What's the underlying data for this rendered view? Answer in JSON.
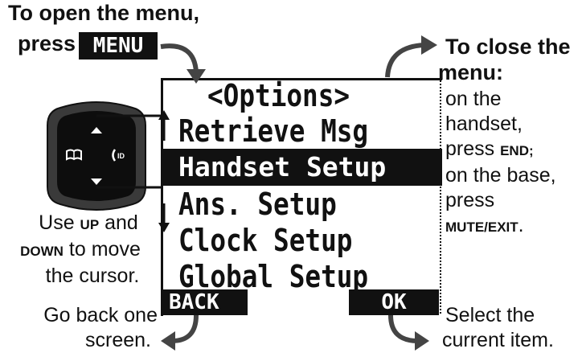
{
  "open_menu": {
    "line1": "To open the menu,",
    "line2": "press",
    "menu_key_label": "MENU"
  },
  "close_menu": {
    "heading1": "To close the",
    "heading2": "menu:",
    "lines": [
      "on the",
      "handset,",
      "press ",
      "on the base,",
      "press"
    ],
    "end_key": "END",
    "end_suffix": ";",
    "mute_exit_key": "MUTE/EXIT",
    "mute_suffix": "."
  },
  "screen": {
    "title": "<Options>",
    "options": [
      "Retrieve Msg",
      "Handset Setup",
      "Ans. Setup",
      "Clock Setup",
      "Global Setup"
    ],
    "selected_index": 1,
    "back_softkey": "BACK",
    "ok_softkey": "OK"
  },
  "cursor_help": {
    "line1_pre": "Use ",
    "up_key": "UP",
    "line1_post": " and",
    "down_key": "DOWN",
    "line2_post": " to move",
    "line3": "the cursor."
  },
  "back_help": {
    "line1": "Go back one",
    "line2": "screen."
  },
  "ok_help": {
    "line1": "Select the",
    "line2": "current item."
  },
  "nav_key": {
    "left_icon": "phonebook-icon",
    "right_icon": "caller-id-icon",
    "right_label": "ID"
  },
  "colors": {
    "ink": "#111111",
    "nav_pad": "#3a3a3a",
    "nav_center": "#0d0d0d"
  }
}
